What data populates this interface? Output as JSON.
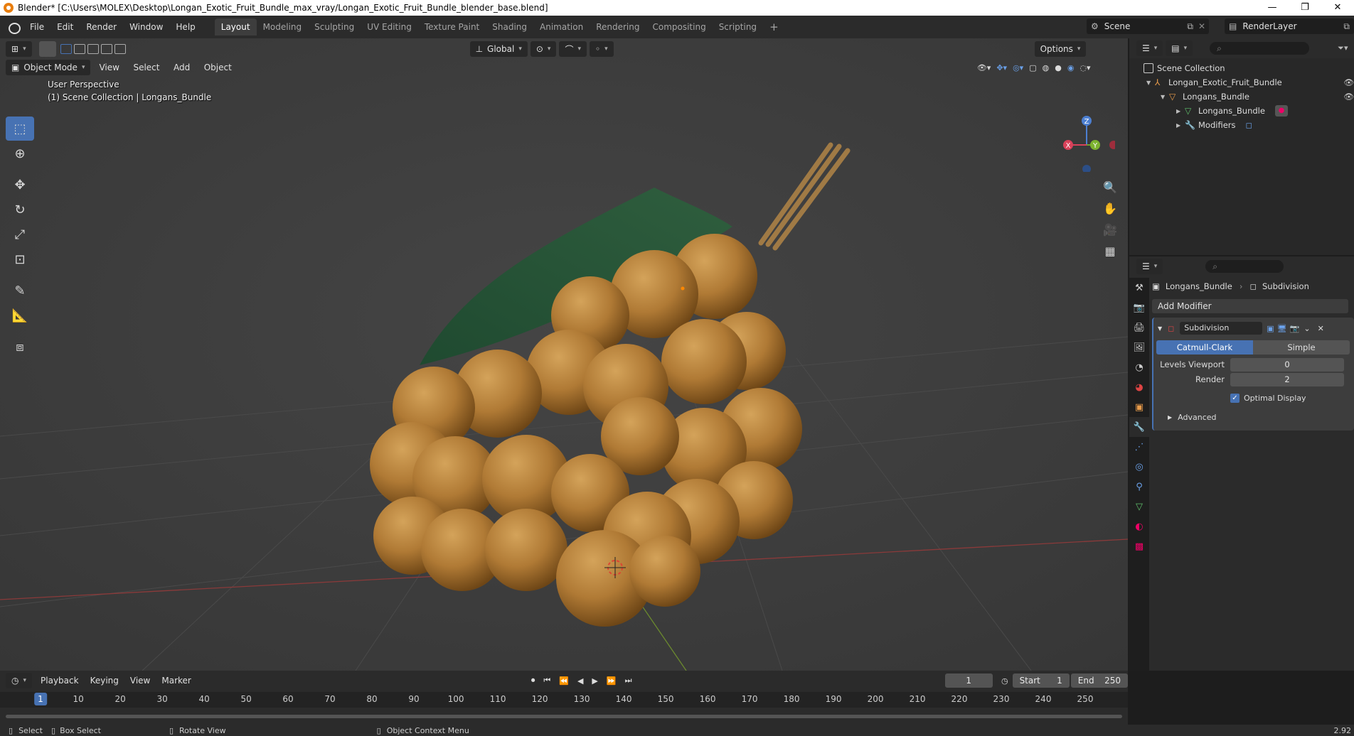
{
  "window": {
    "title": "Blender* [C:\\Users\\MOLEX\\Desktop\\Longan_Exotic_Fruit_Bundle_max_vray/Longan_Exotic_Fruit_Bundle_blender_base.blend]",
    "minimize": "—",
    "restore": "❐",
    "close": "✕"
  },
  "menu": {
    "file": "File",
    "edit": "Edit",
    "render": "Render",
    "window": "Window",
    "help": "Help"
  },
  "workspaces": [
    "Layout",
    "Modeling",
    "Sculpting",
    "UV Editing",
    "Texture Paint",
    "Shading",
    "Animation",
    "Rendering",
    "Compositing",
    "Scripting"
  ],
  "scene": {
    "name": "Scene",
    "render_layer": "RenderLayer"
  },
  "viewport": {
    "mode": "Object Mode",
    "menu": [
      "View",
      "Select",
      "Add",
      "Object"
    ],
    "transform_orientation": "Global",
    "options": "Options",
    "overlay_line1": "User Perspective",
    "overlay_line2": "(1) Scene Collection | Longans_Bundle",
    "gizmo": {
      "x": "X",
      "y": "Y",
      "z": "Z"
    }
  },
  "outliner": {
    "root": "Scene Collection",
    "items": [
      {
        "label": "Longan_Exotic_Fruit_Bundle"
      },
      {
        "label": "Longans_Bundle"
      },
      {
        "label": "Longans_Bundle"
      },
      {
        "label": "Modifiers"
      }
    ]
  },
  "properties": {
    "object": "Longans_Bundle",
    "modifier_crumb": "Subdivision",
    "add_modifier": "Add Modifier",
    "modifier": {
      "name": "Subdivision",
      "mode_a": "Catmull-Clark",
      "mode_b": "Simple",
      "levels_viewport_label": "Levels Viewport",
      "levels_viewport": "0",
      "render_label": "Render",
      "render": "2",
      "optimal_display": "Optimal Display",
      "advanced": "Advanced"
    }
  },
  "timeline": {
    "menu": [
      "Playback",
      "Keying",
      "View",
      "Marker"
    ],
    "current_frame": "1",
    "start_label": "Start",
    "start": "1",
    "end_label": "End",
    "end": "250",
    "ticks": [
      "1",
      "10",
      "20",
      "30",
      "40",
      "50",
      "60",
      "70",
      "80",
      "90",
      "100",
      "110",
      "120",
      "130",
      "140",
      "150",
      "160",
      "170",
      "180",
      "190",
      "200",
      "210",
      "220",
      "230",
      "240",
      "250"
    ]
  },
  "status": {
    "select": "Select",
    "box_select": "Box Select",
    "rotate": "Rotate View",
    "context": "Object Context Menu",
    "version": "2.92"
  },
  "colors": {
    "accent": "#4772b3",
    "bg": "#3d3d3d",
    "panel": "#2b2b2b"
  }
}
